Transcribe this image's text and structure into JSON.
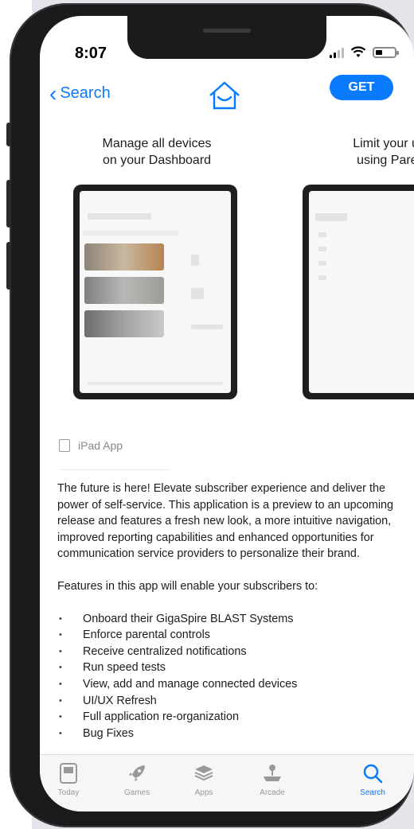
{
  "status": {
    "time": "8:07"
  },
  "nav": {
    "back_label": "Search",
    "get_label": "GET"
  },
  "screenshots": [
    {
      "caption_line1": "Manage all devices",
      "caption_line2": "on your Dashboard"
    },
    {
      "caption_line1": "Limit your use",
      "caption_line2": "using Parent"
    }
  ],
  "ipad_app_label": "iPad App",
  "description": {
    "paragraph1": "The future is here! Elevate subscriber experience and deliver the power of self-service. This application is a preview to an upcoming release and features a fresh new look, a more intuitive navigation, improved reporting capabilities and enhanced opportunities for communication service providers to personalize their brand.",
    "paragraph2": "Features in this app will enable your subscribers to:",
    "features": [
      "Onboard their GigaSpire BLAST Systems",
      "Enforce parental controls",
      "Receive centralized notifications",
      "Run speed tests",
      "View, add and manage connected devices",
      "UI/UX Refresh",
      "Full application re-organization",
      "Bug Fixes"
    ]
  },
  "tabs": [
    {
      "label": "Today",
      "icon": "today-icon"
    },
    {
      "label": "Games",
      "icon": "rocket-icon"
    },
    {
      "label": "Apps",
      "icon": "layers-icon"
    },
    {
      "label": "Arcade",
      "icon": "arcade-joystick-icon"
    },
    {
      "label": "Search",
      "icon": "search-icon",
      "active": true
    }
  ],
  "colors": {
    "accent": "#0a7aff",
    "phone_frame": "#1b1b1d"
  }
}
